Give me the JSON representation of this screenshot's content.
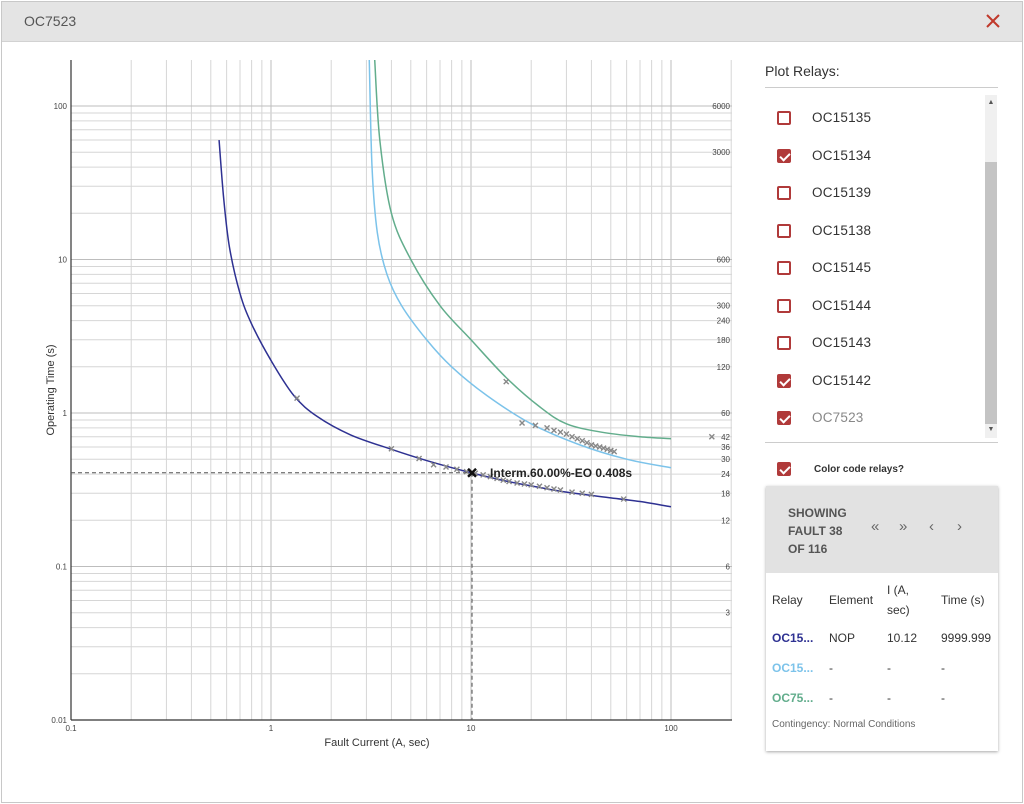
{
  "window": {
    "title": "OC7523",
    "close_icon": "close-icon"
  },
  "chart_data": {
    "type": "line",
    "x_scale": "log",
    "y_scale": "log",
    "xlim": [
      0.1,
      160
    ],
    "ylim": [
      0.01,
      200
    ],
    "xlabel": "Fault Current (A, sec)",
    "ylabel": "Operating Time (s)",
    "x_tick_labels": [
      {
        "v": 0.1,
        "t": "0.1"
      },
      {
        "v": 1,
        "t": "1"
      },
      {
        "v": 10,
        "t": "10"
      },
      {
        "v": 100,
        "t": "100"
      }
    ],
    "y_tick_labels": [
      {
        "v": 100,
        "t": "100"
      },
      {
        "v": 10,
        "t": "10"
      },
      {
        "v": 1,
        "t": "1"
      },
      {
        "v": 0.1,
        "t": "0.1"
      },
      {
        "v": 0.01,
        "t": "0.01"
      }
    ],
    "right_tick_labels": [
      {
        "v": 100,
        "t": "6000"
      },
      {
        "v": 50,
        "t": "3000"
      },
      {
        "v": 10,
        "t": "600"
      },
      {
        "v": 5,
        "t": "300"
      },
      {
        "v": 4,
        "t": "240"
      },
      {
        "v": 3,
        "t": "180"
      },
      {
        "v": 2,
        "t": "120"
      },
      {
        "v": 1,
        "t": "60"
      },
      {
        "v": 0.7,
        "t": "42"
      },
      {
        "v": 0.6,
        "t": "36"
      },
      {
        "v": 0.5,
        "t": "30"
      },
      {
        "v": 0.4,
        "t": "24"
      },
      {
        "v": 0.3,
        "t": "18"
      },
      {
        "v": 0.2,
        "t": "12"
      },
      {
        "v": 0.1,
        "t": "6"
      },
      {
        "v": 0.05,
        "t": "3"
      }
    ],
    "grid": true,
    "series": [
      {
        "name": "OC15134",
        "color": "#2e3192",
        "x": [
          0.55,
          0.58,
          0.62,
          0.7,
          0.8,
          1.0,
          1.3,
          1.7,
          2.5,
          4,
          6,
          10,
          15,
          20,
          30,
          50,
          70,
          100
        ],
        "y": [
          60,
          25,
          12,
          6,
          3.8,
          2.2,
          1.3,
          0.95,
          0.72,
          0.58,
          0.49,
          0.408,
          0.36,
          0.335,
          0.305,
          0.28,
          0.265,
          0.245
        ],
        "markers": {
          "x": [
            1.35,
            4,
            5.5,
            6.5,
            7.5,
            8.5,
            9.5,
            10.5,
            11.5,
            12.5,
            13.5,
            14.5,
            15.5,
            17,
            18.5,
            20,
            22,
            24,
            26,
            28,
            32,
            36,
            40,
            58
          ],
          "y": [
            1.25,
            0.585,
            0.505,
            0.46,
            0.445,
            0.43,
            0.415,
            0.405,
            0.395,
            0.385,
            0.375,
            0.365,
            0.358,
            0.35,
            0.345,
            0.34,
            0.333,
            0.326,
            0.32,
            0.315,
            0.305,
            0.3,
            0.295,
            0.275
          ]
        }
      },
      {
        "name": "OC15142",
        "color": "#7cc3ea",
        "x": [
          3.1,
          3.2,
          3.4,
          3.8,
          4.5,
          6,
          8,
          12,
          20,
          35,
          60,
          100
        ],
        "y": [
          200,
          40,
          15,
          8,
          5,
          3,
          2,
          1.3,
          0.85,
          0.62,
          0.5,
          0.44
        ],
        "markers": {
          "x": [],
          "y": []
        }
      },
      {
        "name": "OC7523",
        "color": "#62ad8c",
        "x": [
          3.3,
          3.5,
          4,
          5,
          7,
          10,
          15,
          22,
          30,
          45,
          70,
          100
        ],
        "y": [
          200,
          60,
          20,
          10,
          5,
          3,
          1.7,
          1.1,
          0.85,
          0.75,
          0.7,
          0.68
        ],
        "markers": {
          "x": [
            15,
            18,
            21,
            24,
            26,
            28,
            30,
            32,
            34,
            36,
            38,
            40,
            42,
            44,
            46,
            48,
            50,
            52,
            160
          ],
          "y": [
            1.6,
            0.86,
            0.83,
            0.8,
            0.77,
            0.75,
            0.73,
            0.7,
            0.68,
            0.66,
            0.64,
            0.62,
            0.61,
            0.6,
            0.59,
            0.58,
            0.57,
            0.56,
            0.7
          ]
        }
      }
    ],
    "highlight": {
      "x": 10.12,
      "y": 0.408,
      "label": "Interm.60.00%-EO 0.408s"
    }
  },
  "sidebar": {
    "plot_title": "Plot Relays:",
    "relays": [
      {
        "label": "OC15135",
        "checked": false
      },
      {
        "label": "OC15134",
        "checked": true
      },
      {
        "label": "OC15139",
        "checked": false
      },
      {
        "label": "OC15138",
        "checked": false
      },
      {
        "label": "OC15145",
        "checked": false
      },
      {
        "label": "OC15144",
        "checked": false
      },
      {
        "label": "OC15143",
        "checked": false
      },
      {
        "label": "OC15142",
        "checked": true
      },
      {
        "label": "OC7523",
        "checked": true
      }
    ],
    "color_code_label": "Color code relays?",
    "color_code_checked": true
  },
  "fault": {
    "line1": "SHOWING",
    "line2": "FAULT 38",
    "line3": "OF 116",
    "nav": {
      "first": "«",
      "last": "»",
      "prev": "‹",
      "next": "›"
    },
    "headers": {
      "relay": "Relay",
      "element": "Element",
      "current": "I (A,",
      "current2": "sec)",
      "time": "Time (s)"
    },
    "rows": [
      {
        "relay": "OC15...",
        "color": "#2e3192",
        "element": "NOP",
        "current": "10.12",
        "time": "9999.999"
      },
      {
        "relay": "OC15...",
        "color": "#7cc3ea",
        "element": "-",
        "current": "-",
        "time": "-"
      },
      {
        "relay": "OC75...",
        "color": "#62ad8c",
        "element": "-",
        "current": "-",
        "time": "-"
      }
    ],
    "contingency": "Contingency: Normal Conditions"
  }
}
